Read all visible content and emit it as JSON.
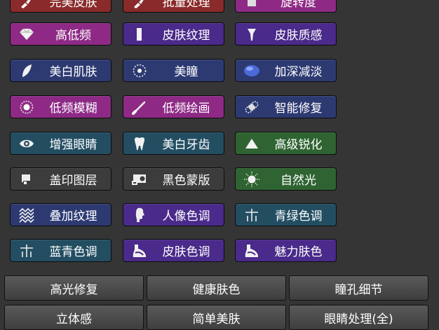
{
  "colors": {
    "magenta": "#8e2a86",
    "purple": "#4a2a8a",
    "navy": "#2d3a72",
    "red": "#8a2a2a",
    "teal": "#234e62",
    "green": "#2f6432",
    "gray": "#3c3c3c",
    "background": "#353535"
  },
  "rows": [
    [
      {
        "label": "完美皮肤",
        "icon": "brush-icon",
        "color": "red"
      },
      {
        "label": "批量处理",
        "icon": "brush-icon",
        "color": "red"
      },
      {
        "label": "旋转度",
        "icon": "square-icon",
        "color": "magenta"
      }
    ],
    [
      {
        "label": "高低频",
        "icon": "diamond-icon",
        "color": "magenta"
      },
      {
        "label": "皮肤纹理",
        "icon": "bar-icon",
        "color": "purple"
      },
      {
        "label": "皮肤质感",
        "icon": "pin-icon",
        "color": "purple"
      }
    ],
    [
      {
        "label": "美白肌肤",
        "icon": "leaf-icon",
        "color": "navy"
      },
      {
        "label": "美瞳",
        "icon": "dotted-circle-icon",
        "color": "navy"
      },
      {
        "label": "加深减淡",
        "icon": "blob-icon",
        "color": "navy"
      }
    ],
    [
      {
        "label": "低频模糊",
        "icon": "ring-icon",
        "color": "magenta"
      },
      {
        "label": "低频绘画",
        "icon": "slash-brush-icon",
        "color": "magenta"
      },
      {
        "label": "智能修复",
        "icon": "bandage-icon",
        "color": "navy"
      }
    ],
    [
      {
        "label": "增强眼睛",
        "icon": "eye-icon",
        "color": "teal"
      },
      {
        "label": "美白牙齿",
        "icon": "tooth-icon",
        "color": "teal"
      },
      {
        "label": "高级锐化",
        "icon": "triangle-icon",
        "color": "green"
      }
    ],
    [
      {
        "label": "盖印图层",
        "icon": "stamp-icon",
        "color": "gray"
      },
      {
        "label": "黑色蒙版",
        "icon": "mask-icon",
        "color": "gray"
      },
      {
        "label": "自然光",
        "icon": "sun-icon",
        "color": "green"
      }
    ],
    [
      {
        "label": "叠加纹理",
        "icon": "texture-icon",
        "color": "navy"
      },
      {
        "label": "人像色调",
        "icon": "portrait-icon",
        "color": "purple"
      },
      {
        "label": "青绿色调",
        "icon": "crosshair-icon",
        "color": "teal"
      }
    ],
    [
      {
        "label": "蓝青色调",
        "icon": "crosshair-icon",
        "color": "teal"
      },
      {
        "label": "皮肤色调",
        "icon": "skin-icon",
        "color": "purple"
      },
      {
        "label": "魅力肤色",
        "icon": "skin-icon",
        "color": "purple"
      }
    ]
  ],
  "bottom_rows": [
    [
      "高光修复",
      "健康肤色",
      "瞳孔细节"
    ],
    [
      "立体感",
      "简单美肤",
      "眼睛处理(全)"
    ]
  ]
}
